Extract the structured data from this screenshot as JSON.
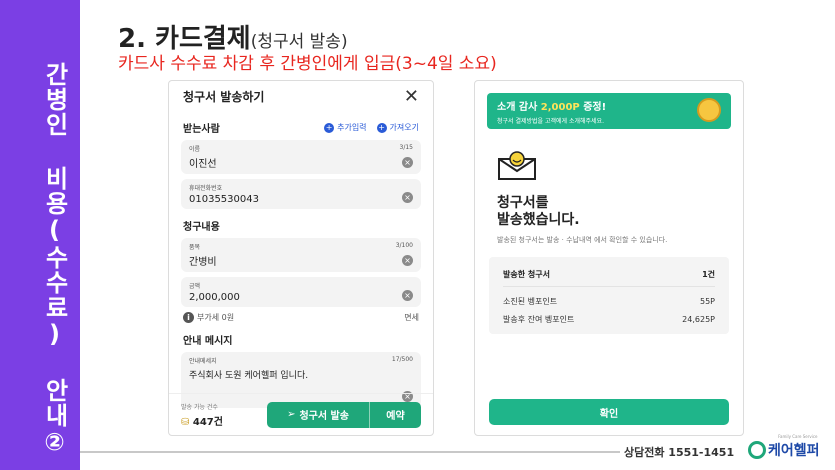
{
  "side_title": "간병인 비용(수수료) 안내②",
  "header": {
    "title_main": "2. 카드결제",
    "title_sub": "(청구서 발송)",
    "subtitle": "카드사 수수료 차감 후 간병인에게 입금(3~4일 소요)"
  },
  "phone1": {
    "title": "청구서 발송하기",
    "close_glyph": "✕",
    "recipient_label": "받는사람",
    "link_direct": "추가입력",
    "link_import": "가져오기",
    "name_label": "이름",
    "name_count": "3/15",
    "name_value": "이진선",
    "phone_label": "휴대전화번호",
    "phone_value": "01035530043",
    "billing_label": "청구내용",
    "item_label": "품목",
    "item_count": "3/100",
    "item_value": "간병비",
    "amount_label": "금액",
    "amount_value": "2,000,000",
    "vat_text": "부가세 0원",
    "vat_right": "면세",
    "message_section": "안내 메시지",
    "message_label": "안내메세지",
    "message_count": "17/500",
    "message_value": "주식회사 도원 케어헬퍼 입니다.",
    "count_label": "발송 가능 건수",
    "count_value": "447건",
    "send_button": "청구서 발송",
    "reserve_button": "예약"
  },
  "phone2": {
    "banner_title_a": "소개 감사 ",
    "banner_title_b": "2,000P",
    "banner_title_c": " 증정!",
    "banner_sub": "청구서 결제방법을 고객에게 소개해주세요.",
    "done_title_1": "청구서를",
    "done_title_2": "발송했습니다.",
    "done_desc": "발송된 청구서는 발송 · 수납내역 에서 확인할 수 있습니다.",
    "sum_head_label": "발송한 청구서",
    "sum_head_value": "1건",
    "row1_label": "소진된 벵포인트",
    "row1_value": "55P",
    "row2_label": "발송후 잔여 벵포인트",
    "row2_value": "24,625P",
    "confirm_button": "확인"
  },
  "footer": {
    "phone_text": "상담전화 1551-1451",
    "brand": "케어헬퍼",
    "brand_tiny": "Family Care Service"
  },
  "colors": {
    "purple": "#7b3fe4",
    "green": "#1fa77a",
    "red": "#e8261f",
    "blue": "#2a5bd7"
  }
}
